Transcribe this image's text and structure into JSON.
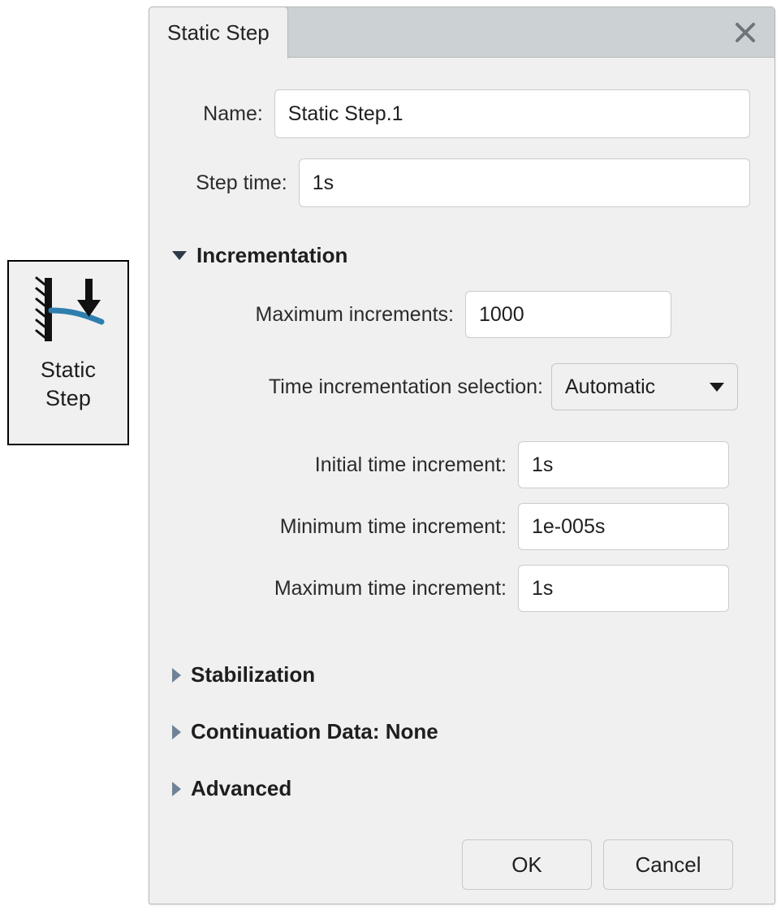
{
  "palette": {
    "icon_name": "static-step-cantilever-icon",
    "caption_line1": "Static",
    "caption_line2": "Step"
  },
  "dialog": {
    "tab_label": "Static Step",
    "close_icon": "close-icon",
    "fields": [
      {
        "label": "Name:",
        "value": "Static Step.1"
      },
      {
        "label": "Step time:",
        "value": "1s"
      }
    ],
    "incrementation": {
      "header": "Incrementation",
      "expanded": true,
      "marker": "triangle-down-icon",
      "max_increments": {
        "label": "Maximum increments:",
        "value": "1000"
      },
      "time_selection": {
        "label": "Time incrementation selection:",
        "value": "Automatic",
        "caret": "chevron-down-icon"
      },
      "initial_time": {
        "label": "Initial time increment:",
        "value": "1s"
      },
      "minimum_time": {
        "label": "Minimum time increment:",
        "value": "1e-005s"
      },
      "maximum_time": {
        "label": "Maximum time increment:",
        "value": "1s"
      }
    },
    "collapsed_sections": [
      {
        "header": "Stabilization",
        "marker": "triangle-right-icon"
      },
      {
        "header": "Continuation Data:  None",
        "marker": "triangle-right-icon"
      },
      {
        "header": "Advanced",
        "marker": "triangle-right-icon"
      }
    ],
    "buttons": {
      "ok": "OK",
      "cancel": "Cancel"
    }
  },
  "colors": {
    "dialog_bg": "#f0f0f0",
    "titlebar_bg": "#ccd1d3",
    "border": "#b4b8ba",
    "input_bg": "#ffffff",
    "input_border": "#c8cdd0",
    "beam_blue": "#2e7fae",
    "text": "#1f1f1f"
  }
}
